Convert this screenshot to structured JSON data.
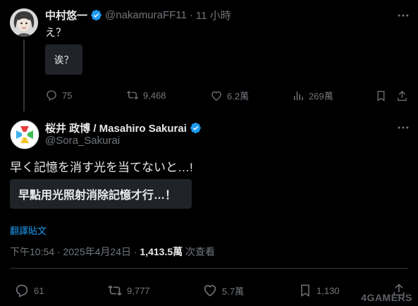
{
  "tweet1": {
    "author_name": "中村悠一",
    "handle": "@nakamuraFF11",
    "separator": "·",
    "time": "11 小時",
    "text": "え？",
    "translation": "诶？",
    "stats": {
      "replies": "75",
      "retweets": "9,468",
      "likes": "6.2萬",
      "views": "269萬"
    }
  },
  "tweet2": {
    "author_name": "桜井 政博 / Masahiro Sakurai",
    "handle": "@Sora_Sakurai",
    "text": "早く記憶を消す光を当てないと…!",
    "translation": "早點用光照射消除記憶才行…！",
    "translate_label": "翻譯貼文",
    "timestamp": "下午10:54 · 2025年4月24日 · ",
    "views_count": "1,413.5萬",
    "views_suffix": " 次查看",
    "stats": {
      "replies": "61",
      "retweets": "9,777",
      "likes": "5.7萬",
      "bookmarks": "1,130"
    }
  },
  "watermark": "4GAMERS",
  "colors": {
    "background": "#000000",
    "primary_text": "#e7e9ea",
    "secondary_text": "#71767b",
    "link": "#1d9bf0",
    "verified": "#1d9bf0",
    "translation_box": "#202327"
  }
}
